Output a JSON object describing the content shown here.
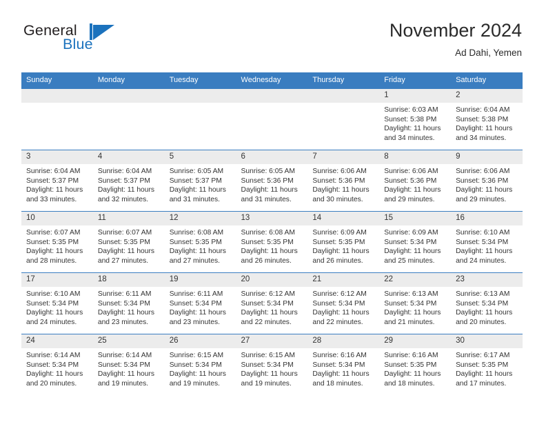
{
  "brand": {
    "word1": "General",
    "word2": "Blue",
    "mark": "triangle-logo"
  },
  "header": {
    "title": "November 2024",
    "subtitle": "Ad Dahi, Yemen"
  },
  "colors": {
    "header_blue": "#3a7dc0",
    "brand_blue": "#1b72bd",
    "daynum_bg": "#ececec",
    "text": "#333333"
  },
  "weekdays": [
    "Sunday",
    "Monday",
    "Tuesday",
    "Wednesday",
    "Thursday",
    "Friday",
    "Saturday"
  ],
  "weeks": [
    [
      {
        "day": "",
        "blank": true
      },
      {
        "day": "",
        "blank": true
      },
      {
        "day": "",
        "blank": true
      },
      {
        "day": "",
        "blank": true
      },
      {
        "day": "",
        "blank": true
      },
      {
        "day": "1",
        "sunrise": "Sunrise: 6:03 AM",
        "sunset": "Sunset: 5:38 PM",
        "daylight": "Daylight: 11 hours and 34 minutes."
      },
      {
        "day": "2",
        "sunrise": "Sunrise: 6:04 AM",
        "sunset": "Sunset: 5:38 PM",
        "daylight": "Daylight: 11 hours and 34 minutes."
      }
    ],
    [
      {
        "day": "3",
        "sunrise": "Sunrise: 6:04 AM",
        "sunset": "Sunset: 5:37 PM",
        "daylight": "Daylight: 11 hours and 33 minutes."
      },
      {
        "day": "4",
        "sunrise": "Sunrise: 6:04 AM",
        "sunset": "Sunset: 5:37 PM",
        "daylight": "Daylight: 11 hours and 32 minutes."
      },
      {
        "day": "5",
        "sunrise": "Sunrise: 6:05 AM",
        "sunset": "Sunset: 5:37 PM",
        "daylight": "Daylight: 11 hours and 31 minutes."
      },
      {
        "day": "6",
        "sunrise": "Sunrise: 6:05 AM",
        "sunset": "Sunset: 5:36 PM",
        "daylight": "Daylight: 11 hours and 31 minutes."
      },
      {
        "day": "7",
        "sunrise": "Sunrise: 6:06 AM",
        "sunset": "Sunset: 5:36 PM",
        "daylight": "Daylight: 11 hours and 30 minutes."
      },
      {
        "day": "8",
        "sunrise": "Sunrise: 6:06 AM",
        "sunset": "Sunset: 5:36 PM",
        "daylight": "Daylight: 11 hours and 29 minutes."
      },
      {
        "day": "9",
        "sunrise": "Sunrise: 6:06 AM",
        "sunset": "Sunset: 5:36 PM",
        "daylight": "Daylight: 11 hours and 29 minutes."
      }
    ],
    [
      {
        "day": "10",
        "sunrise": "Sunrise: 6:07 AM",
        "sunset": "Sunset: 5:35 PM",
        "daylight": "Daylight: 11 hours and 28 minutes."
      },
      {
        "day": "11",
        "sunrise": "Sunrise: 6:07 AM",
        "sunset": "Sunset: 5:35 PM",
        "daylight": "Daylight: 11 hours and 27 minutes."
      },
      {
        "day": "12",
        "sunrise": "Sunrise: 6:08 AM",
        "sunset": "Sunset: 5:35 PM",
        "daylight": "Daylight: 11 hours and 27 minutes."
      },
      {
        "day": "13",
        "sunrise": "Sunrise: 6:08 AM",
        "sunset": "Sunset: 5:35 PM",
        "daylight": "Daylight: 11 hours and 26 minutes."
      },
      {
        "day": "14",
        "sunrise": "Sunrise: 6:09 AM",
        "sunset": "Sunset: 5:35 PM",
        "daylight": "Daylight: 11 hours and 26 minutes."
      },
      {
        "day": "15",
        "sunrise": "Sunrise: 6:09 AM",
        "sunset": "Sunset: 5:34 PM",
        "daylight": "Daylight: 11 hours and 25 minutes."
      },
      {
        "day": "16",
        "sunrise": "Sunrise: 6:10 AM",
        "sunset": "Sunset: 5:34 PM",
        "daylight": "Daylight: 11 hours and 24 minutes."
      }
    ],
    [
      {
        "day": "17",
        "sunrise": "Sunrise: 6:10 AM",
        "sunset": "Sunset: 5:34 PM",
        "daylight": "Daylight: 11 hours and 24 minutes."
      },
      {
        "day": "18",
        "sunrise": "Sunrise: 6:11 AM",
        "sunset": "Sunset: 5:34 PM",
        "daylight": "Daylight: 11 hours and 23 minutes."
      },
      {
        "day": "19",
        "sunrise": "Sunrise: 6:11 AM",
        "sunset": "Sunset: 5:34 PM",
        "daylight": "Daylight: 11 hours and 23 minutes."
      },
      {
        "day": "20",
        "sunrise": "Sunrise: 6:12 AM",
        "sunset": "Sunset: 5:34 PM",
        "daylight": "Daylight: 11 hours and 22 minutes."
      },
      {
        "day": "21",
        "sunrise": "Sunrise: 6:12 AM",
        "sunset": "Sunset: 5:34 PM",
        "daylight": "Daylight: 11 hours and 22 minutes."
      },
      {
        "day": "22",
        "sunrise": "Sunrise: 6:13 AM",
        "sunset": "Sunset: 5:34 PM",
        "daylight": "Daylight: 11 hours and 21 minutes."
      },
      {
        "day": "23",
        "sunrise": "Sunrise: 6:13 AM",
        "sunset": "Sunset: 5:34 PM",
        "daylight": "Daylight: 11 hours and 20 minutes."
      }
    ],
    [
      {
        "day": "24",
        "sunrise": "Sunrise: 6:14 AM",
        "sunset": "Sunset: 5:34 PM",
        "daylight": "Daylight: 11 hours and 20 minutes."
      },
      {
        "day": "25",
        "sunrise": "Sunrise: 6:14 AM",
        "sunset": "Sunset: 5:34 PM",
        "daylight": "Daylight: 11 hours and 19 minutes."
      },
      {
        "day": "26",
        "sunrise": "Sunrise: 6:15 AM",
        "sunset": "Sunset: 5:34 PM",
        "daylight": "Daylight: 11 hours and 19 minutes."
      },
      {
        "day": "27",
        "sunrise": "Sunrise: 6:15 AM",
        "sunset": "Sunset: 5:34 PM",
        "daylight": "Daylight: 11 hours and 19 minutes."
      },
      {
        "day": "28",
        "sunrise": "Sunrise: 6:16 AM",
        "sunset": "Sunset: 5:34 PM",
        "daylight": "Daylight: 11 hours and 18 minutes."
      },
      {
        "day": "29",
        "sunrise": "Sunrise: 6:16 AM",
        "sunset": "Sunset: 5:35 PM",
        "daylight": "Daylight: 11 hours and 18 minutes."
      },
      {
        "day": "30",
        "sunrise": "Sunrise: 6:17 AM",
        "sunset": "Sunset: 5:35 PM",
        "daylight": "Daylight: 11 hours and 17 minutes."
      }
    ]
  ]
}
